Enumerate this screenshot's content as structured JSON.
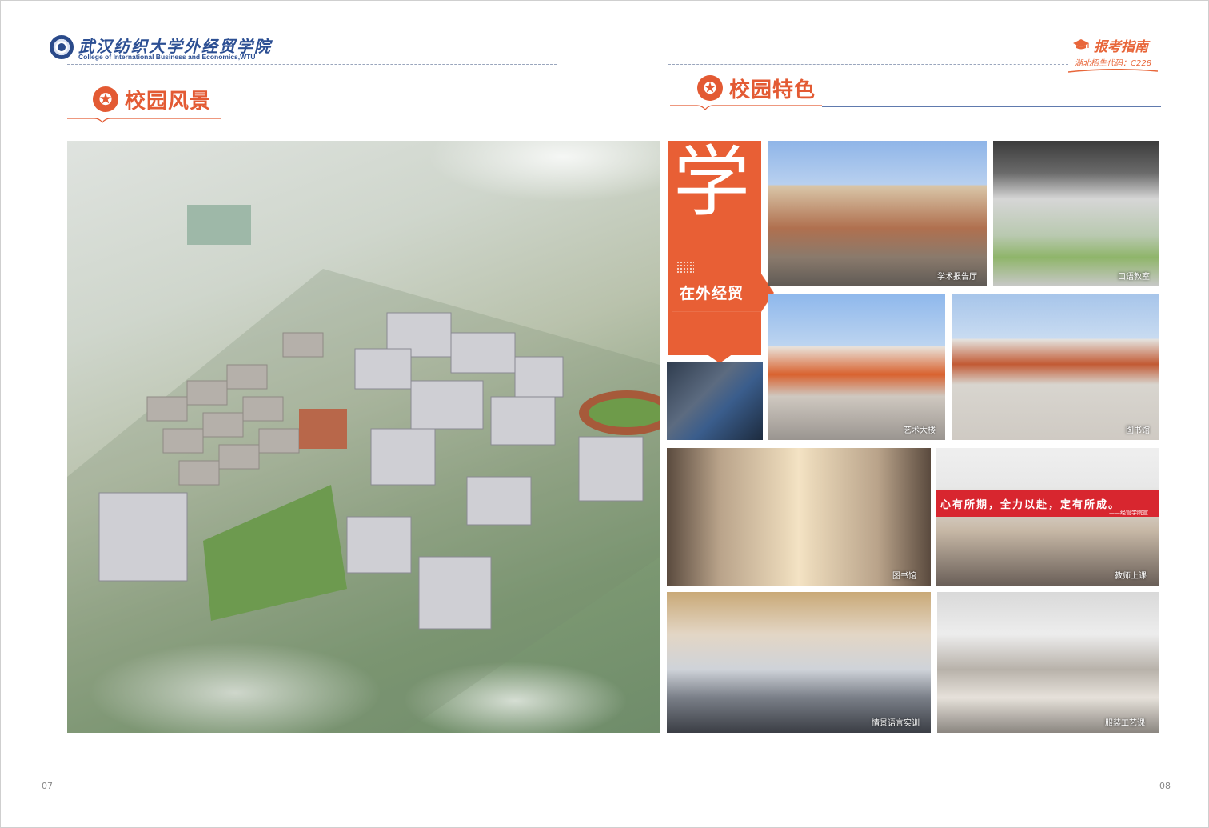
{
  "header": {
    "school_name_cn": "武汉纺织大学外经贸学院",
    "school_name_en": "College of International Business and Economics,WTU",
    "guide_title": "报考指南",
    "guide_code": "湖北招生代码：C228"
  },
  "sections": {
    "left_title": "校园风景",
    "right_title": "校园特色"
  },
  "feature": {
    "big_char": "学",
    "banner_text": "在外经贸"
  },
  "photos": {
    "hall": "学术报告厅",
    "oral": "口语教室",
    "art": "艺术大楼",
    "library_exterior": "图书馆",
    "library_interior": "图书馆",
    "classroom": "教师上课",
    "vr": "情景语言实训",
    "sewing": "服装工艺课"
  },
  "slogan": {
    "text": "心有所期，全力以赴，定有所成。",
    "sign": "——经管学院宣"
  },
  "page_numbers": {
    "left": "07",
    "right": "08"
  },
  "colors": {
    "accent": "#e35a33",
    "brand_blue": "#2c4f93",
    "slogan_red": "#d8262f"
  }
}
